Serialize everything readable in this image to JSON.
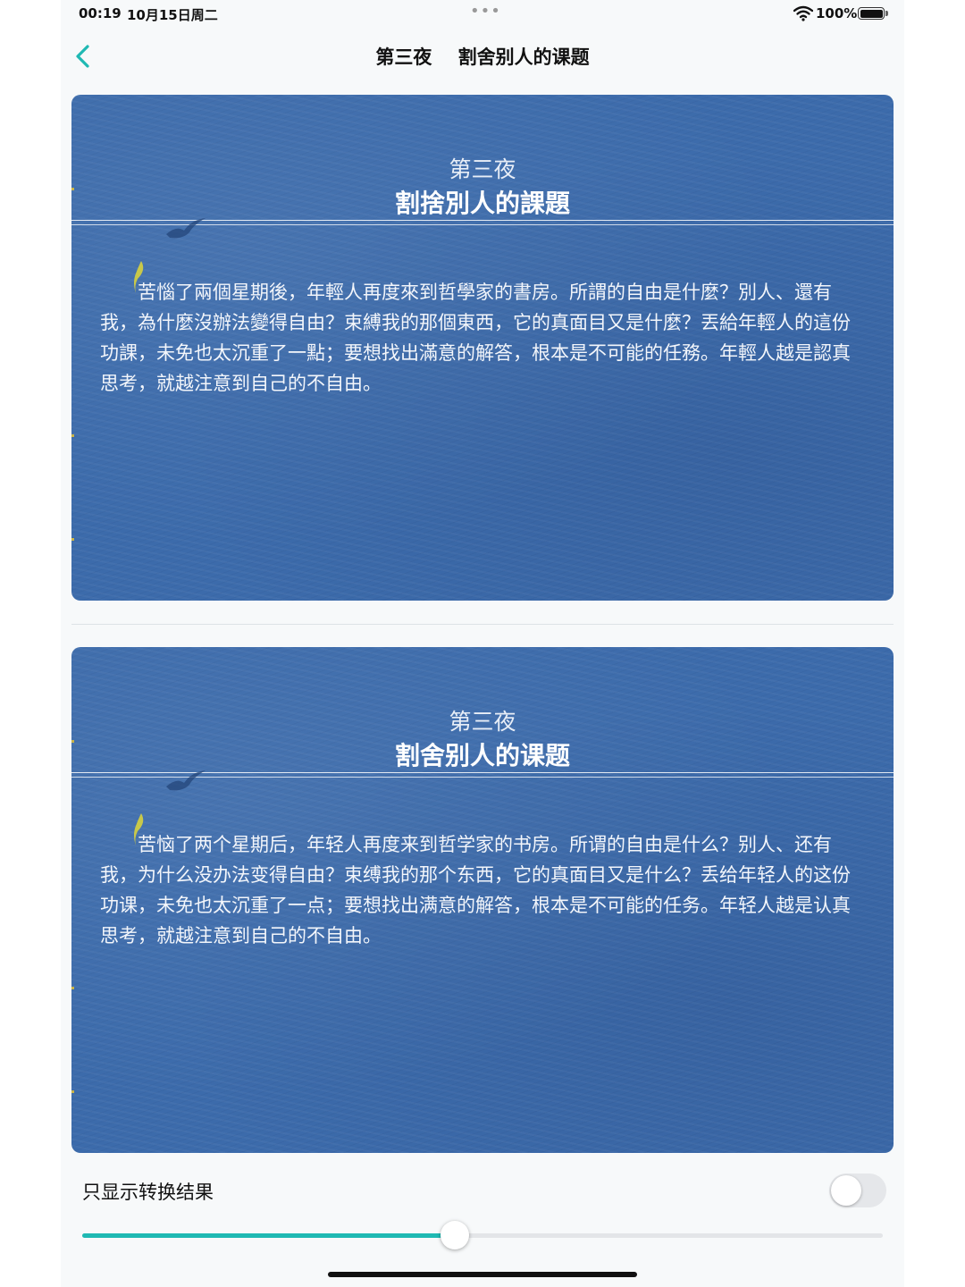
{
  "status_bar": {
    "time": "00:19",
    "date": "10月15日周二",
    "center_dots": "•••",
    "battery": "100%"
  },
  "nav": {
    "back_icon": "chevron-left-icon",
    "title": "第三夜    割舍别人的课题"
  },
  "cards": [
    {
      "chapter": "第三夜",
      "heading": "割捨別人的課題",
      "body": "苦惱了兩個星期後，年輕人再度來到哲學家的書房。所謂的自由是什麼？別人、還有我，為什麼沒辦法變得自由？束縛我的那個東西，它的真面目又是什麼？丟給年輕人的這份功課，未免也太沉重了一點；要想找出滿意的解答，根本是不可能的任務。年輕人越是認真思考，就越注意到自己的不自由。"
    },
    {
      "chapter": "第三夜",
      "heading": "割舍别人的课题",
      "body": "苦恼了两个星期后，年轻人再度来到哲学家的书房。所谓的自由是什么？别人、还有我，为什么没办法变得自由？束缚我的那个东西，它的真面目又是什么？丢给年轻人的这份功课，未免也太沉重了一点；要想找出满意的解答，根本是不可能的任务。年轻人越是认真思考，就越注意到自己的不自由。"
    }
  ],
  "controls": {
    "toggle_label": "只显示转换结果",
    "toggle_on": false,
    "slider_value": 0.465
  },
  "colors": {
    "accent": "#1fb9b3",
    "card_blue": "#3c6bab"
  }
}
